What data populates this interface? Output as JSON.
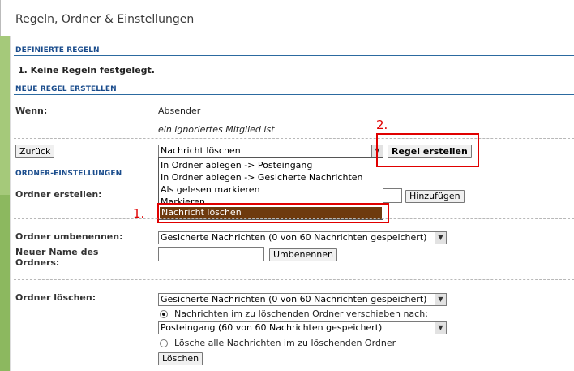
{
  "header": {
    "title": "Regeln, Ordner & Einstellungen"
  },
  "defined_rules": {
    "heading": "DEFINIERTE REGELN",
    "item": "1.  Keine Regeln festgelegt."
  },
  "new_rule": {
    "heading": "NEUE REGEL ERSTELLEN",
    "when_label": "Wenn:",
    "sender": "Absender",
    "condition": "ein ignoriertes Mitglied ist",
    "back_button": "Zurück",
    "action_select_value": "Nachricht löschen",
    "create_button": "Regel erstellen"
  },
  "action_dropdown": {
    "options": [
      "In Ordner ablegen -> Posteingang",
      "In Ordner ablegen -> Gesicherte Nachrichten",
      "Als gelesen markieren",
      "Markieren",
      "Nachricht löschen"
    ],
    "selected_index": 4
  },
  "annotations": {
    "step1": "1.",
    "step2": "2.",
    "color": "#e00000"
  },
  "folder_settings": {
    "heading": "ORDNER-EINSTELLUNGEN",
    "create_label": "Ordner erstellen:",
    "add_button": "Hinzufügen",
    "rename_label": "Ordner umbenennen:",
    "rename_select": "Gesicherte Nachrichten (0 von 60 Nachrichten gespeichert)",
    "new_name_label": "Neuer Name des Ordners:",
    "rename_button": "Umbenennen",
    "delete_label": "Ordner löschen:",
    "delete_select": "Gesicherte Nachrichten (0 von 60 Nachrichten gespeichert)",
    "move_option": "Nachrichten im zu löschenden Ordner verschieben nach:",
    "move_target_select": "Posteingang (60 von 60 Nachrichten gespeichert)",
    "delete_all_option": "Lösche alle Nachrichten im zu löschenden Ordner",
    "delete_button": "Löschen"
  },
  "colors": {
    "page_background": "#a5c97a",
    "heading": "#1a4c8c",
    "selected_option": "#6e3a0e"
  }
}
